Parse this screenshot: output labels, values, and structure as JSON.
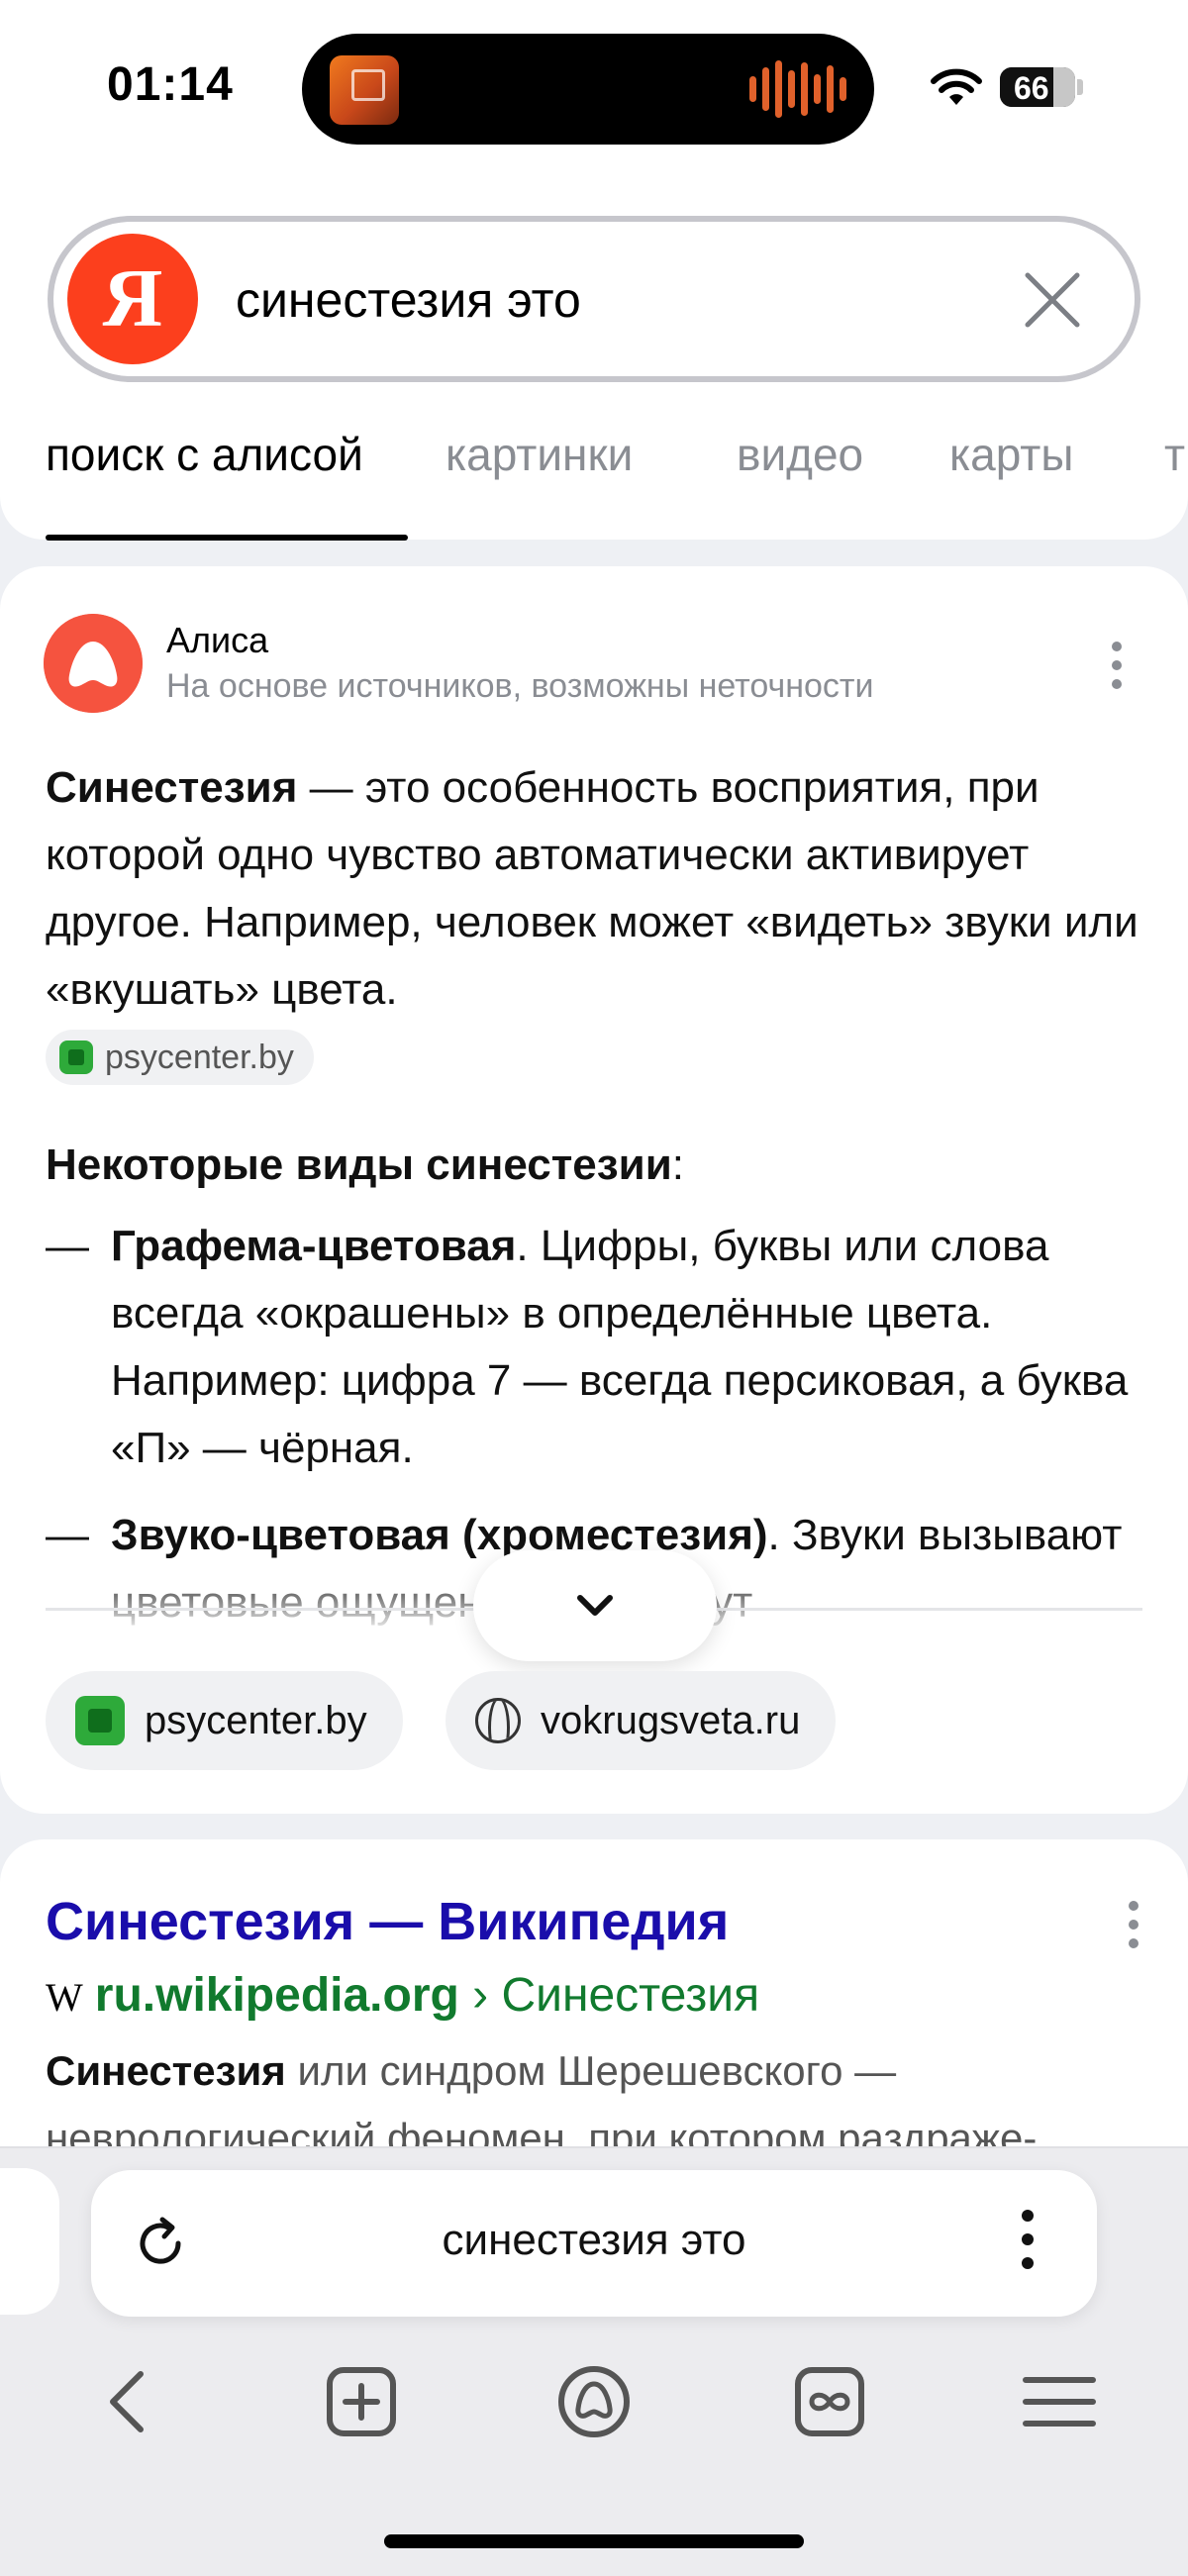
{
  "status_bar": {
    "time": "01:14",
    "battery": "66"
  },
  "search": {
    "logo": "Я",
    "query": "синестезия это",
    "clear_icon": "close-icon"
  },
  "tabs": [
    {
      "label": "поиск с алисой",
      "active": true
    },
    {
      "label": "картинки",
      "active": false
    },
    {
      "label": "видео",
      "active": false
    },
    {
      "label": "карты",
      "active": false
    },
    {
      "label": "т",
      "active": false
    }
  ],
  "alice": {
    "name": "Алиса",
    "subtitle": "На основе источников, возможны неточности",
    "intro_term": "Синестезия",
    "intro_text": " — это особенность восприятия, при которой одно чувство автоматически активирует другое. Например, человек может «видеть» звуки или «вкушать» цвета.",
    "intro_source": "psycenter.by",
    "section_title": "Некоторые виды синестезии",
    "section_colon": ":",
    "items": [
      {
        "dash": "—",
        "term": "Графема-цветовая",
        "text": ". Цифры, буквы или слова всегда «окрашены» в определённые цвета. Например: цифра 7 — всегда персиковая, а буква «П» — чёрная."
      },
      {
        "dash": "—",
        "term": "Звуко-цветовая (хроместезия)",
        "text": ". Звуки вызывают цветовые ощущения. Это могут"
      }
    ],
    "sources": [
      "psycenter.by",
      "vokrugsveta.ru"
    ],
    "expand_icon": "chevron-down-icon"
  },
  "result": {
    "title": "Синестезия — Википедия",
    "site_icon": "W",
    "domain": "ru.wikipedia.org",
    "path": " › Синестезия",
    "snippet_term": "Синестезия",
    "snippet_text": " или синдром Шерешевского — неврологический феномен, при котором раздраже-"
  },
  "address_bar": {
    "text": "синестезия это",
    "reload_icon": "reload-icon",
    "menu_icon": "more-vertical-icon"
  },
  "bottom_nav": [
    {
      "name": "back-icon"
    },
    {
      "name": "new-tab-icon"
    },
    {
      "name": "alice-icon"
    },
    {
      "name": "tabs-icon"
    },
    {
      "name": "menu-icon"
    }
  ],
  "colors": {
    "yandex_red": "#fc3f1d",
    "alice_coral": "#f5533f",
    "link_blue": "#1a0dab",
    "url_green": "#117a2e"
  }
}
